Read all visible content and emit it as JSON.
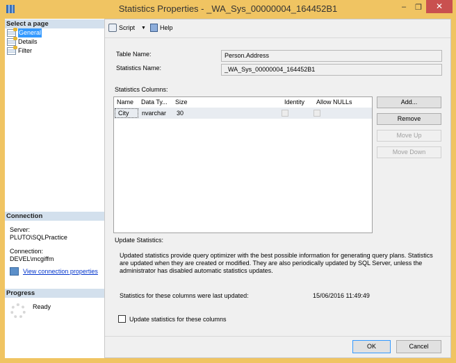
{
  "window": {
    "title": "Statistics Properties - _WA_Sys_00000004_164452B1",
    "minimize": "–",
    "maximize": "❐",
    "close": "✕"
  },
  "sidebar": {
    "header": "Select a page",
    "pages": [
      {
        "label": "General",
        "selected": true
      },
      {
        "label": "Details"
      },
      {
        "label": "Filter"
      }
    ]
  },
  "connection": {
    "header": "Connection",
    "server_label": "Server:",
    "server": "PLUTO\\SQLPractice",
    "connection_label": "Connection:",
    "connection": "DEVEL\\mcgiffm",
    "link": "View connection properties"
  },
  "progress": {
    "header": "Progress",
    "status": "Ready"
  },
  "toolbar": {
    "script": "Script",
    "help": "Help"
  },
  "form": {
    "table_name_label": "Table Name:",
    "table_name": "Person.Address",
    "stats_name_label": "Statistics Name:",
    "stats_name": "_WA_Sys_00000004_164452B1",
    "columns_label": "Statistics Columns:"
  },
  "grid": {
    "headers": [
      "Name",
      "Data Ty...",
      "Size",
      "Identity",
      "Allow NULLs"
    ],
    "rows": [
      {
        "name": "City",
        "type": "nvarchar",
        "size": "30",
        "identity": false,
        "allow_nulls": false
      }
    ]
  },
  "buttons": {
    "add": "Add...",
    "remove": "Remove",
    "move_up": "Move Up",
    "move_down": "Move Down",
    "ok": "OK",
    "cancel": "Cancel"
  },
  "update": {
    "header": "Update Statistics:",
    "description": "Updated statistics provide query optimizer with the best possible information for generating query plans. Statistics are updated when they are created or modified. They are also periodically updated by SQL Server, unless the administrator has disabled automatic statistics updates.",
    "last_updated_label": "Statistics for these columns were last updated:",
    "last_updated": "15/06/2016 11:49:49",
    "checkbox_label": "Update statistics for these columns",
    "checked": false
  }
}
